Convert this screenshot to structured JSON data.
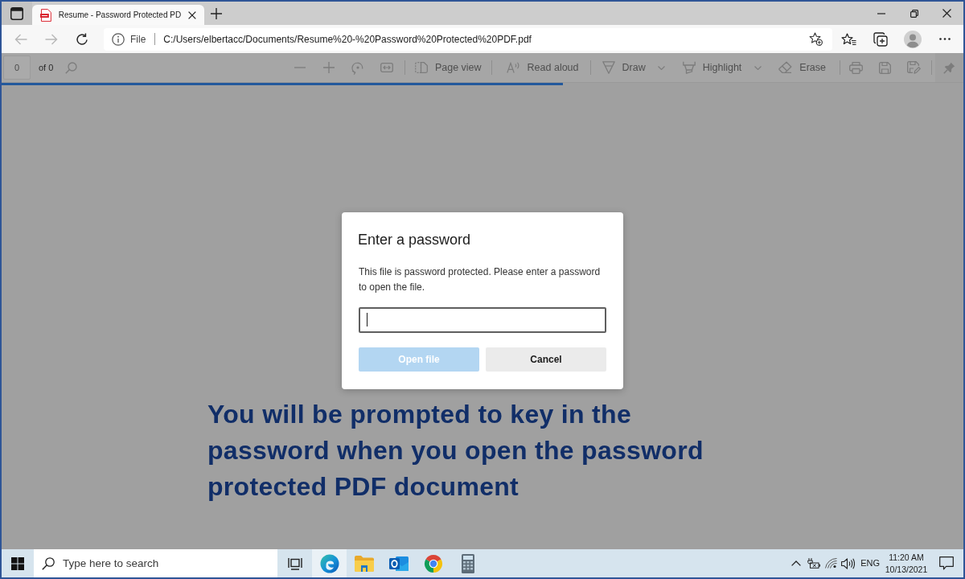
{
  "browser": {
    "tabs": [
      {
        "title": "Resume - Password Protected PD",
        "selected": true
      }
    ],
    "nav_buttons": [
      {
        "disabled": true
      },
      {
        "disabled": true
      },
      {
        "disabled": false
      }
    ],
    "address_bar": {
      "scheme": "File",
      "url": "C:/Users/elbertacc/Documents/Resume%20-%20Password%20Protected%20PDF.pdf"
    }
  },
  "pdf_toolbar": {
    "page_number": "0",
    "page_count": "of 0",
    "tools": [
      {
        "label": "Page view",
        "menu": false
      },
      {
        "label": "Read aloud",
        "menu": false
      },
      {
        "label": "Draw",
        "menu": true
      },
      {
        "label": "Highlight",
        "menu": true
      },
      {
        "label": "Erase",
        "menu": false
      }
    ]
  },
  "loading_bar": {
    "level": 0.584
  },
  "dialog": {
    "title": "Enter a password",
    "message": "This file is password protected. Please enter a password to open the file.",
    "password_field": {
      "focused": true
    },
    "buttons": [
      {
        "label": "Open file",
        "kind": "primary",
        "disabled": true
      },
      {
        "label": "Cancel",
        "kind": "secondary",
        "disabled": false
      }
    ]
  },
  "caption": "You will be prompted to key in the password when you open the password protected PDF document",
  "taskbar": {
    "search": {
      "placeholder": "Type here to search"
    },
    "apps": [
      {
        "active": true
      },
      {
        "active": false
      },
      {
        "active": false
      },
      {
        "active": false
      },
      {
        "active": false
      }
    ],
    "language": "ENG",
    "time": "11:20 AM",
    "date": "10/13/2021"
  }
}
